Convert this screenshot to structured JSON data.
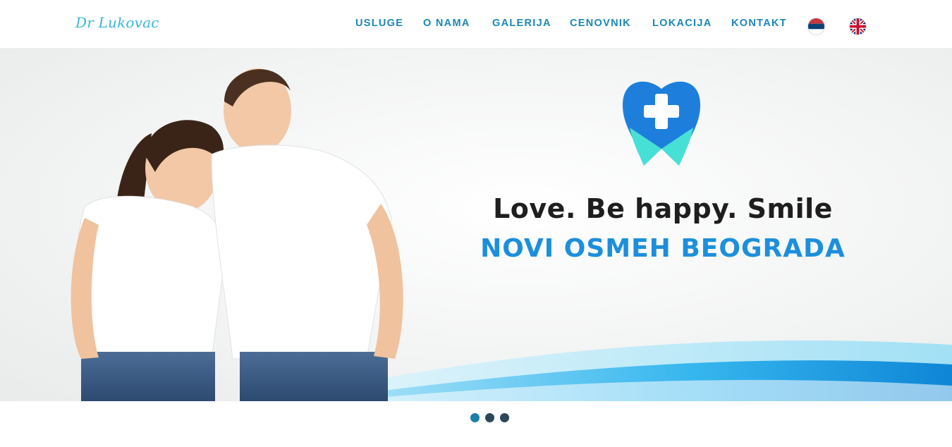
{
  "brand": {
    "logo_text": "Dr Lukovac"
  },
  "nav": {
    "items": [
      {
        "label": "USLUGE"
      },
      {
        "label": "O NAMA"
      },
      {
        "label": "GALERIJA"
      },
      {
        "label": "CENOVNIK"
      },
      {
        "label": "LOKACIJA"
      },
      {
        "label": "KONTAKT"
      }
    ],
    "languages": [
      {
        "code": "sr",
        "icon": "serbian-flag-icon"
      },
      {
        "code": "en",
        "icon": "uk-flag-icon"
      }
    ]
  },
  "hero": {
    "slide": {
      "tagline": "Love. Be happy. Smile",
      "subline": "NOVI OSMEH BEOGRADA",
      "logo_icon": "tooth-cross-icon"
    }
  },
  "slider": {
    "dots": 3,
    "active_index": 0
  },
  "colors": {
    "accent": "#1b88b6",
    "logo": "#38b6d8",
    "subline": "#1c8fdc",
    "tagline": "#1e1e1e",
    "dot": "#2c4757",
    "dot_active": "#1b7fa6"
  }
}
